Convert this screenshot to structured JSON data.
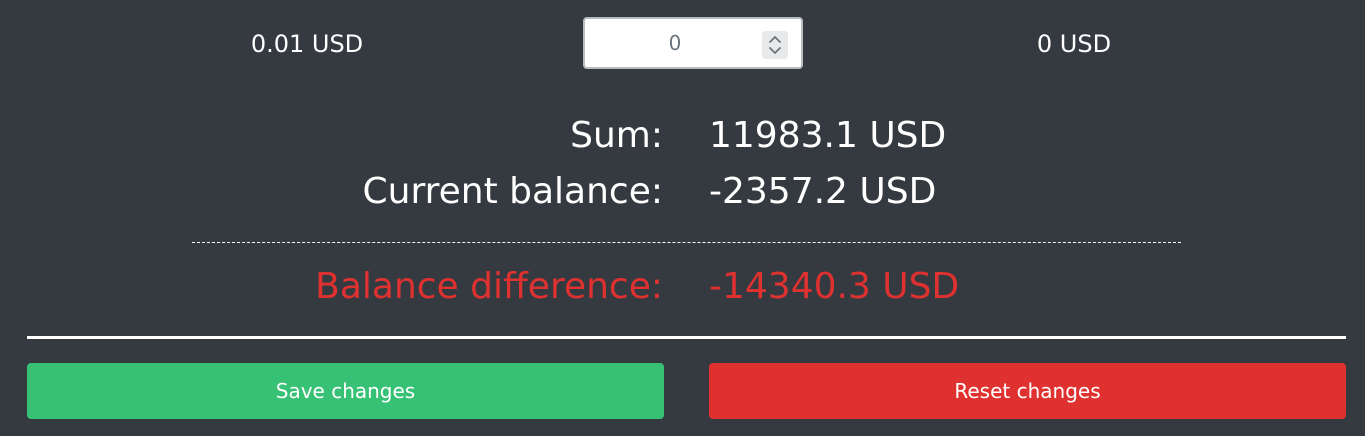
{
  "denomination_row": {
    "denomination": "0.01 USD",
    "quantity_value": "0",
    "subtotal": "0 USD"
  },
  "summary": {
    "sum_label": "Sum:",
    "sum_value": "11983.1 USD",
    "current_balance_label": "Current balance:",
    "current_balance_value": "-2357.2 USD",
    "balance_difference_label": "Balance difference:",
    "balance_difference_value": "-14340.3 USD"
  },
  "actions": {
    "save_label": "Save changes",
    "reset_label": "Reset changes"
  },
  "colors": {
    "background": "#343a40",
    "save": "#37c174",
    "reset": "#e03131",
    "negative_text": "#e03131"
  },
  "icons": {
    "spinner": "up-down-chevron-icon"
  }
}
